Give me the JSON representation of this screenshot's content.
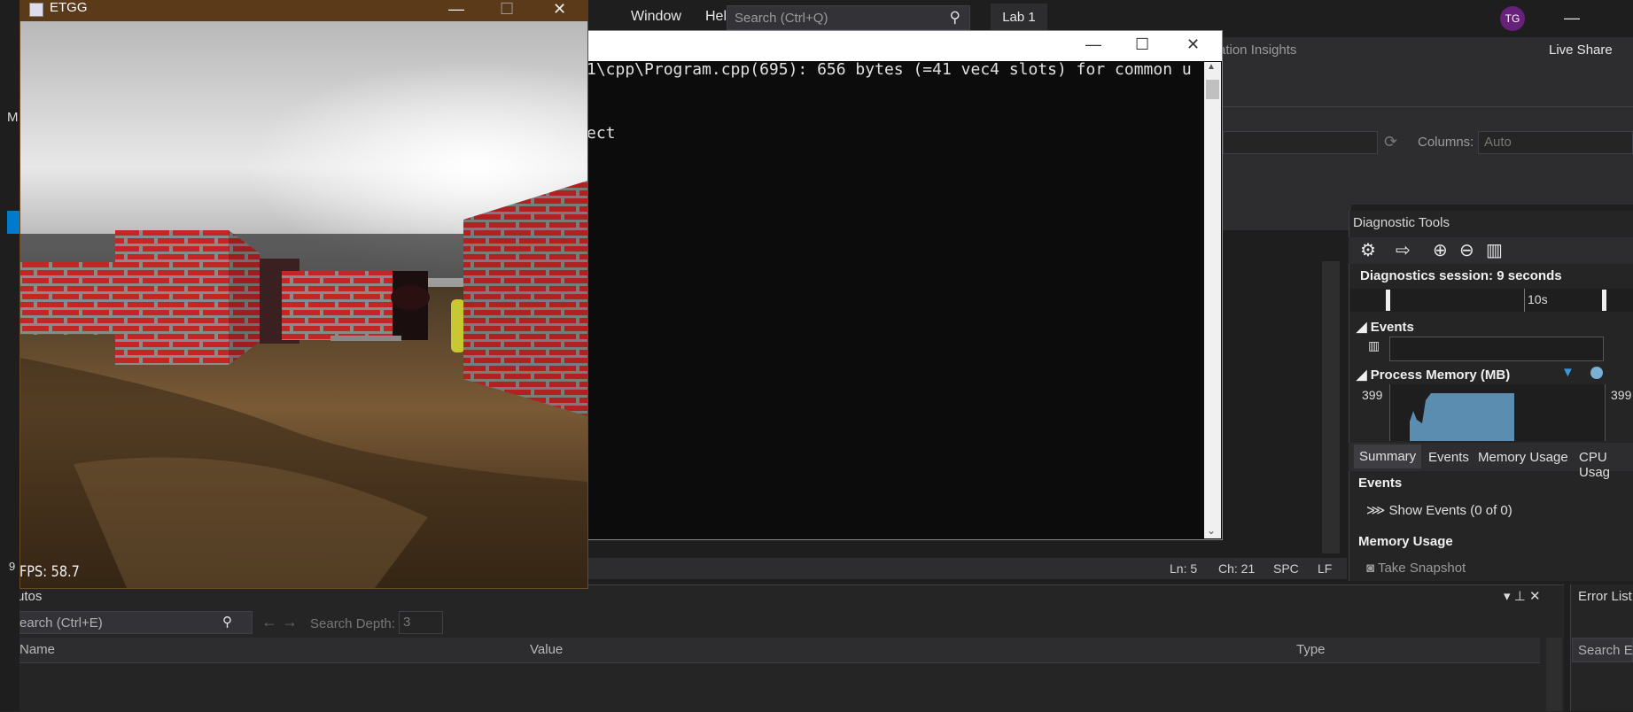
{
  "vs": {
    "menu": [
      "Window",
      "Help"
    ],
    "search_placeholder": "Search (Ctrl+Q)",
    "solution_name": "Lab 1",
    "user_initials": "TG",
    "app_insights": "ation Insights",
    "live_share": "Live Share",
    "columns_label": "Columns:",
    "columns_value": "Auto",
    "left_label": "M",
    "left_number": "9"
  },
  "status_bar": {
    "ln": "Ln: 5",
    "ch": "Ch: 21",
    "spc": "SPC",
    "lf": "LF"
  },
  "diagnostics": {
    "title": "Diagnostic Tools",
    "session": "Diagnostics session: 9 seconds",
    "timeline_label": "10s",
    "events_header": "Events",
    "process_memory_header": "Process Memory (MB)",
    "mem_value_left": "399",
    "mem_value_right": "399",
    "tabs": [
      "Summary",
      "Events",
      "Memory Usage",
      "CPU Usag"
    ],
    "summary_events_header": "Events",
    "show_events": "Show Events (0 of 0)",
    "memory_usage_header": "Memory Usage",
    "take_snapshot": "Take Snapshot"
  },
  "autos": {
    "title": "Autos",
    "search_placeholder": "Search (Ctrl+E)",
    "depth_label": "Search Depth:",
    "depth_value": "3",
    "columns": [
      "Name",
      "Value",
      "Type"
    ]
  },
  "error_list": {
    "title": "Error List",
    "search": "Search Er"
  },
  "console": {
    "line1": "1\\cpp\\Program.cpp(695): 656 bytes (=41 vec4 slots) for common u",
    "line2": "ect"
  },
  "game": {
    "title": "ETGG",
    "fps": "FPS: 58.7"
  },
  "colors": {
    "vs_accent": "#007acc",
    "avatar": "#68217a",
    "memory_fill": "#5b8db0",
    "brick": "#b52424"
  }
}
